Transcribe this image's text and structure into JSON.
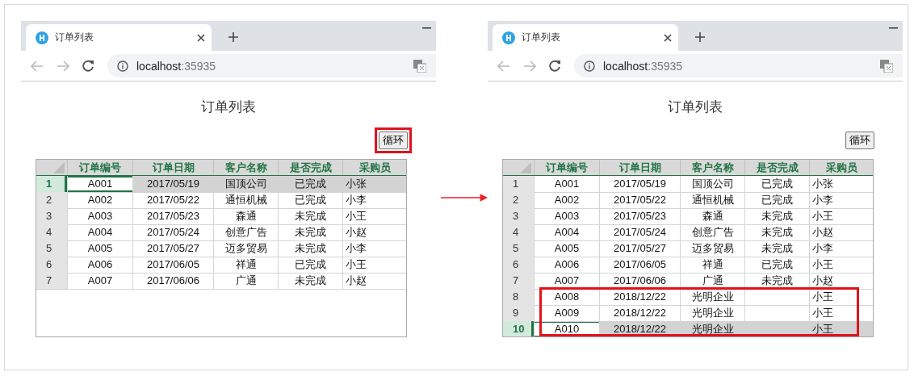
{
  "panels": [
    {
      "tab_title": "订单列表",
      "url_host": "localhost",
      "url_port": ":35935",
      "page_title": "订单列表",
      "button": {
        "label": "循环",
        "highlighted": true
      },
      "columns": [
        "订单编号",
        "订单日期",
        "客户名称",
        "是否完成",
        "采购员"
      ],
      "rows": [
        {
          "row_number": "1",
          "order_no": "A001",
          "order_date": "2017/05/19",
          "customer": "国顶公司",
          "completed": "已完成",
          "buyer": "小张",
          "selected": true,
          "highlighted": false
        },
        {
          "row_number": "2",
          "order_no": "A002",
          "order_date": "2017/05/22",
          "customer": "通恒机械",
          "completed": "已完成",
          "buyer": "小李",
          "selected": false,
          "highlighted": false
        },
        {
          "row_number": "3",
          "order_no": "A003",
          "order_date": "2017/05/23",
          "customer": "森通",
          "completed": "未完成",
          "buyer": "小王",
          "selected": false,
          "highlighted": false
        },
        {
          "row_number": "4",
          "order_no": "A004",
          "order_date": "2017/05/24",
          "customer": "创意广告",
          "completed": "未完成",
          "buyer": "小赵",
          "selected": false,
          "highlighted": false
        },
        {
          "row_number": "5",
          "order_no": "A005",
          "order_date": "2017/05/27",
          "customer": "迈多贸易",
          "completed": "未完成",
          "buyer": "小李",
          "selected": false,
          "highlighted": false
        },
        {
          "row_number": "6",
          "order_no": "A006",
          "order_date": "2017/06/05",
          "customer": "祥通",
          "completed": "已完成",
          "buyer": "小王",
          "selected": false,
          "highlighted": false
        },
        {
          "row_number": "7",
          "order_no": "A007",
          "order_date": "2017/06/06",
          "customer": "广通",
          "completed": "未完成",
          "buyer": "小赵",
          "selected": false,
          "highlighted": false
        }
      ]
    },
    {
      "tab_title": "订单列表",
      "url_host": "localhost",
      "url_port": ":35935",
      "page_title": "订单列表",
      "button": {
        "label": "循环",
        "highlighted": false
      },
      "columns": [
        "订单编号",
        "订单日期",
        "客户名称",
        "是否完成",
        "采购员"
      ],
      "rows": [
        {
          "row_number": "1",
          "order_no": "A001",
          "order_date": "2017/05/19",
          "customer": "国顶公司",
          "completed": "已完成",
          "buyer": "小张",
          "selected": false,
          "highlighted": false
        },
        {
          "row_number": "2",
          "order_no": "A002",
          "order_date": "2017/05/22",
          "customer": "通恒机械",
          "completed": "已完成",
          "buyer": "小李",
          "selected": false,
          "highlighted": false
        },
        {
          "row_number": "3",
          "order_no": "A003",
          "order_date": "2017/05/23",
          "customer": "森通",
          "completed": "未完成",
          "buyer": "小王",
          "selected": false,
          "highlighted": false
        },
        {
          "row_number": "4",
          "order_no": "A004",
          "order_date": "2017/05/24",
          "customer": "创意广告",
          "completed": "未完成",
          "buyer": "小赵",
          "selected": false,
          "highlighted": false
        },
        {
          "row_number": "5",
          "order_no": "A005",
          "order_date": "2017/05/27",
          "customer": "迈多贸易",
          "completed": "未完成",
          "buyer": "小李",
          "selected": false,
          "highlighted": false
        },
        {
          "row_number": "6",
          "order_no": "A006",
          "order_date": "2017/06/05",
          "customer": "祥通",
          "completed": "已完成",
          "buyer": "小王",
          "selected": false,
          "highlighted": false
        },
        {
          "row_number": "7",
          "order_no": "A007",
          "order_date": "2017/06/06",
          "customer": "广通",
          "completed": "未完成",
          "buyer": "小赵",
          "selected": false,
          "highlighted": false
        },
        {
          "row_number": "8",
          "order_no": "A008",
          "order_date": "2018/12/22",
          "customer": "光明企业",
          "buyer": "小王",
          "selected": false,
          "highlighted": true
        },
        {
          "row_number": "9",
          "order_no": "A009",
          "order_date": "2018/12/22",
          "customer": "光明企业",
          "buyer": "小王",
          "selected": false,
          "highlighted": true
        },
        {
          "row_number": "10",
          "order_no": "A010",
          "order_date": "2018/12/22",
          "customer": "光明企业",
          "buyer": "小王",
          "selected": true,
          "highlighted": true
        }
      ]
    }
  ]
}
